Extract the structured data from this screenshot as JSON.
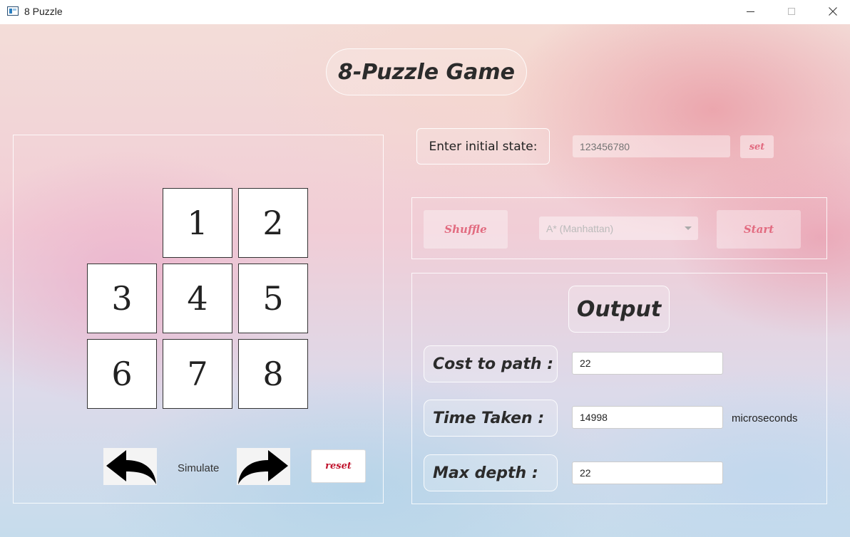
{
  "window": {
    "title": "8 Puzzle"
  },
  "header": {
    "title": "8-Puzzle Game"
  },
  "board": {
    "tiles": [
      "",
      "1",
      "2",
      "3",
      "4",
      "5",
      "6",
      "7",
      "8"
    ],
    "simulate_label": "Simulate",
    "reset_label": "reset",
    "back_icon": "undo-arrow-icon",
    "forward_icon": "redo-arrow-icon"
  },
  "initial_state": {
    "label": "Enter initial state:",
    "placeholder": "123456780",
    "set_label": "set"
  },
  "controls": {
    "shuffle_label": "Shuffle",
    "algorithm_selected": "A* (Manhattan)",
    "start_label": "Start"
  },
  "output": {
    "title": "Output",
    "cost_label": "Cost to path :",
    "cost_value": "22",
    "time_label": "Time Taken :",
    "time_value": "14998",
    "time_unit": "microseconds",
    "depth_label": "Max depth :",
    "depth_value": "22"
  },
  "colors": {
    "accent_text": "#e26b80",
    "reset_text": "#c0132c"
  }
}
